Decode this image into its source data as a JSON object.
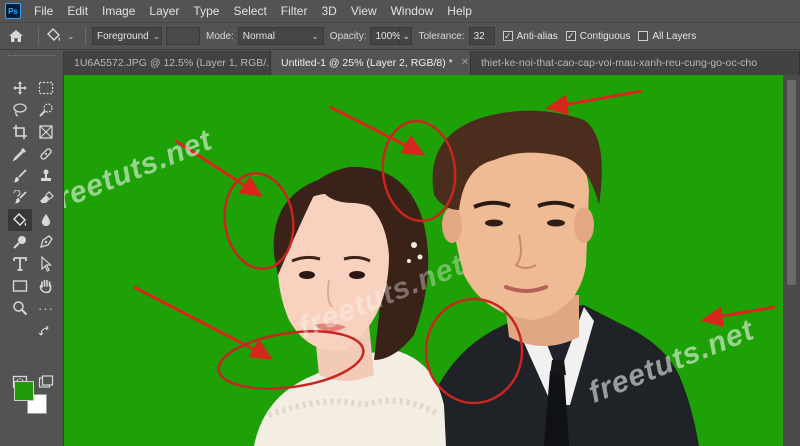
{
  "app": {
    "logo_text": "Ps"
  },
  "menu": [
    "File",
    "Edit",
    "Image",
    "Layer",
    "Type",
    "Select",
    "Filter",
    "3D",
    "View",
    "Window",
    "Help"
  ],
  "options": {
    "fill_source": "Foreground",
    "mode_label": "Mode:",
    "mode_value": "Normal",
    "opacity_label": "Opacity:",
    "opacity_value": "100%",
    "tolerance_label": "Tolerance:",
    "tolerance_value": "32",
    "anti_alias_label": "Anti-alias",
    "anti_alias_checked": true,
    "contiguous_label": "Contiguous",
    "contiguous_checked": true,
    "all_layers_label": "All Layers",
    "all_layers_checked": false
  },
  "tabs": [
    {
      "label": "1U6A5572.JPG @ 12.5% (Layer 1, RGB/...",
      "active": false
    },
    {
      "label": "Untitled-1 @ 25% (Layer 2, RGB/8) *",
      "active": true
    },
    {
      "label": "thiet-ke-noi-that-cao-cap-voi-mau-xanh-reu-cung-go-oc-cho",
      "active": false
    }
  ],
  "colors": {
    "foreground": "#1f9a0a",
    "background": "#ffffff",
    "canvas_green": "#1ea007",
    "annotation_red": "#d9261c"
  },
  "tools": [
    "move-tool",
    "marquee-tool",
    "lasso-tool",
    "quick-selection-tool",
    "crop-tool",
    "frame-tool",
    "eyedropper-tool",
    "healing-brush-tool",
    "brush-tool",
    "clone-stamp-tool",
    "history-brush-tool",
    "eraser-tool",
    "paint-bucket-tool",
    "blur-tool",
    "dodge-tool",
    "pen-tool",
    "type-tool",
    "path-selection-tool",
    "rectangle-tool",
    "hand-tool",
    "zoom-tool",
    "edit-toolbar"
  ],
  "canvas": {
    "watermark": "freetuts.net"
  }
}
